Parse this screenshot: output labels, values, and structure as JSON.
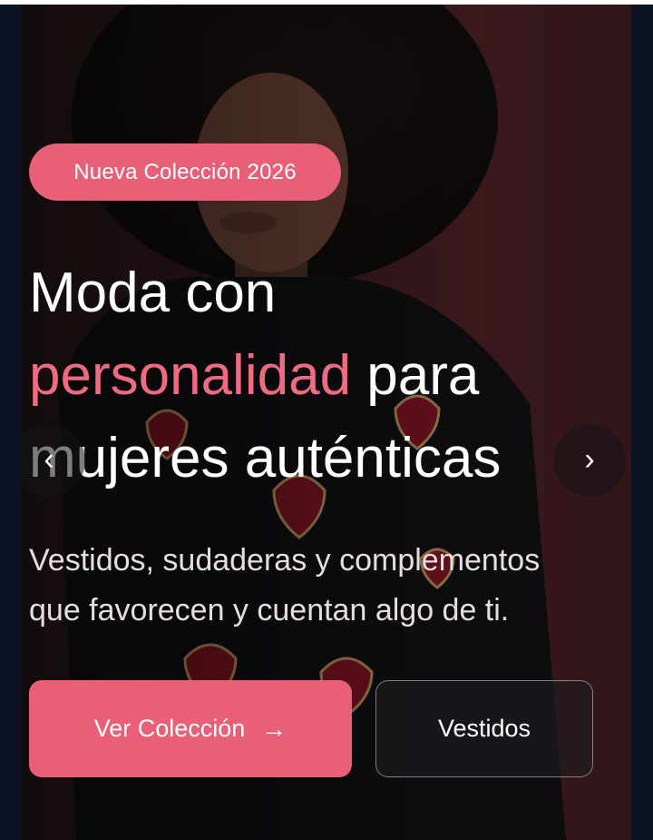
{
  "hero": {
    "badge": "Nueva Colección 2026",
    "title_line1": "Moda con",
    "title_accent": "personalidad",
    "title_line2_rest": "para",
    "title_line3": "mujeres auténticas",
    "subtitle_line1": "Vestidos, sudaderas y complementos",
    "subtitle_line2": "que favorecen y cuentan algo de ti.",
    "accent_color": "#ea5f78"
  },
  "carousel": {
    "prev_glyph": "‹",
    "next_glyph": "›"
  },
  "actions": {
    "primary_label": "Ver Colección",
    "primary_icon": "arrow-right-icon",
    "primary_arrow": "→",
    "secondary_label": "Vestidos"
  }
}
